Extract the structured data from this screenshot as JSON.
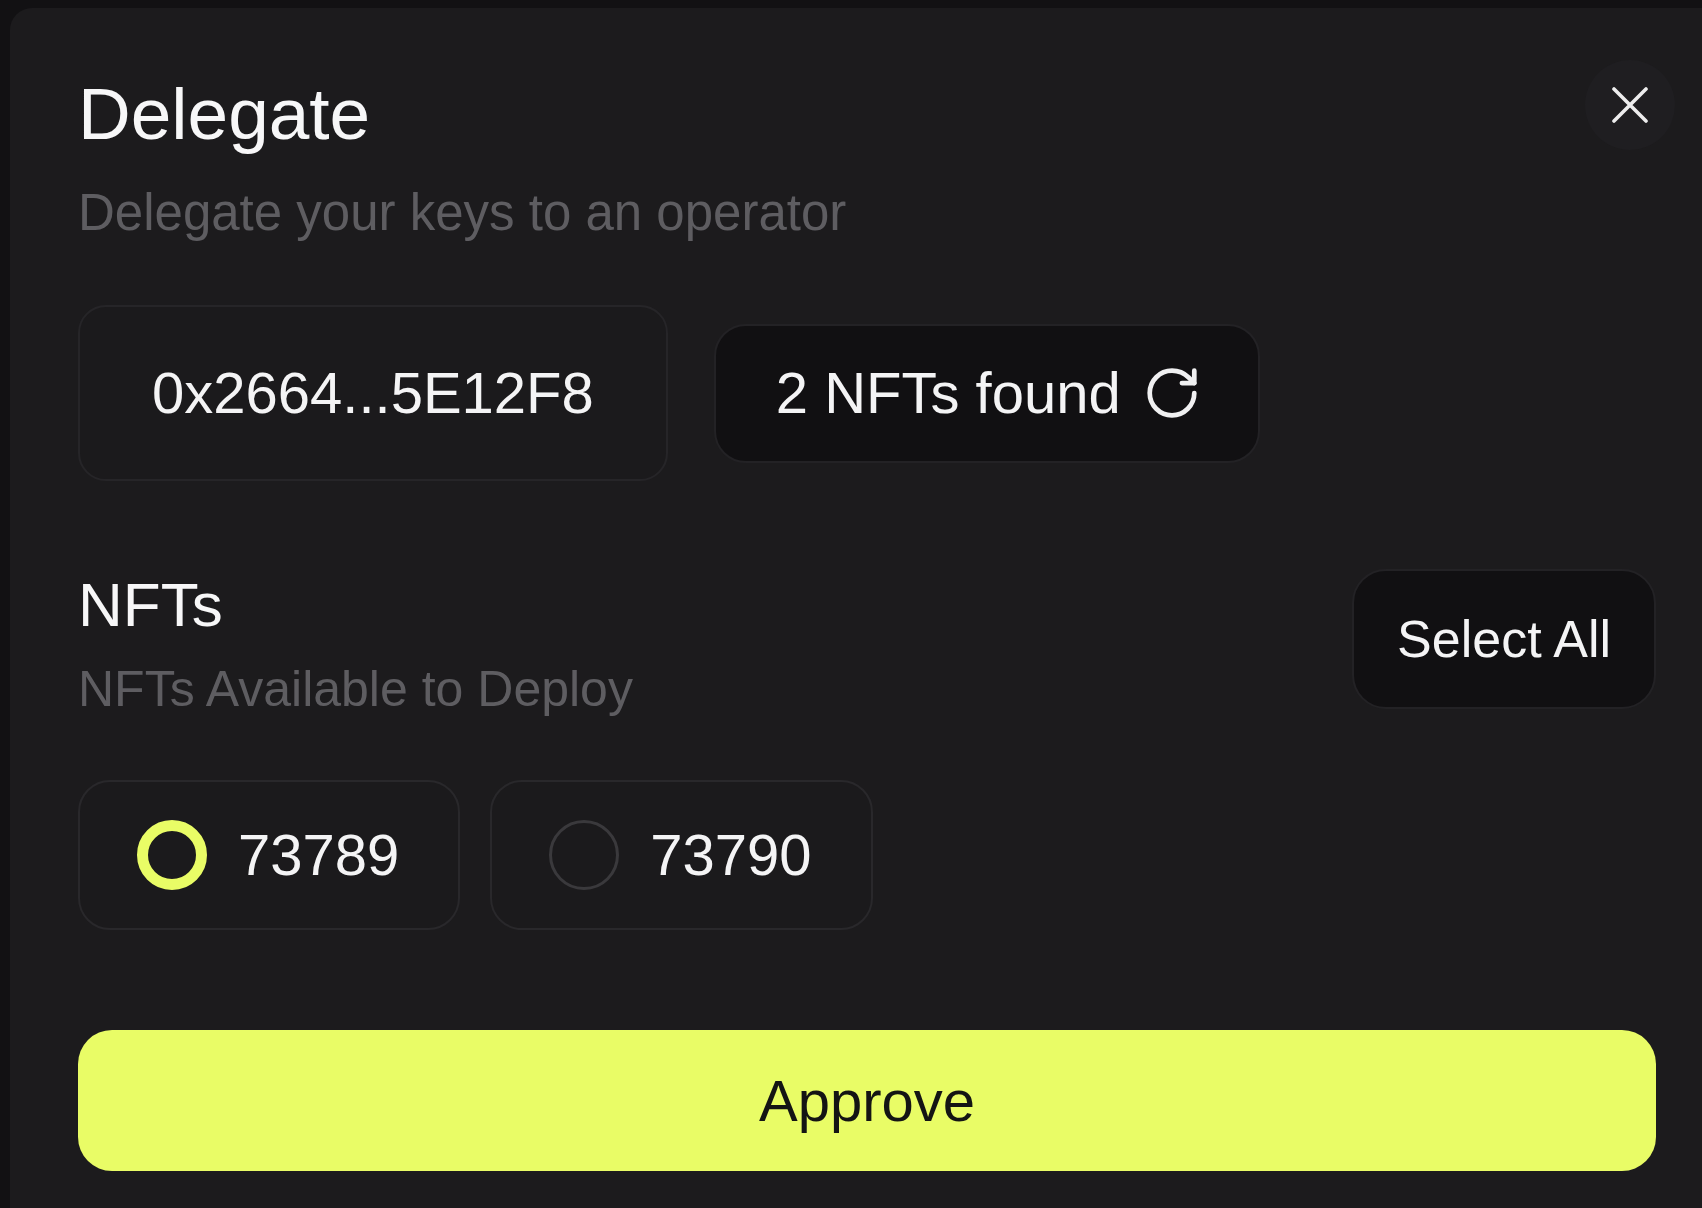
{
  "dialog": {
    "title": "Delegate",
    "subtitle": "Delegate your keys to an operator"
  },
  "wallet": {
    "address": "0x2664...5E12F8"
  },
  "nft_status": {
    "label": "2 NFTs found"
  },
  "nfts_section": {
    "title": "NFTs",
    "subtitle": "NFTs Available to Deploy",
    "select_all": "Select All",
    "items": [
      {
        "label": "73789",
        "selected": true
      },
      {
        "label": "73790",
        "selected": false
      }
    ]
  },
  "approve_button": "Approve"
}
